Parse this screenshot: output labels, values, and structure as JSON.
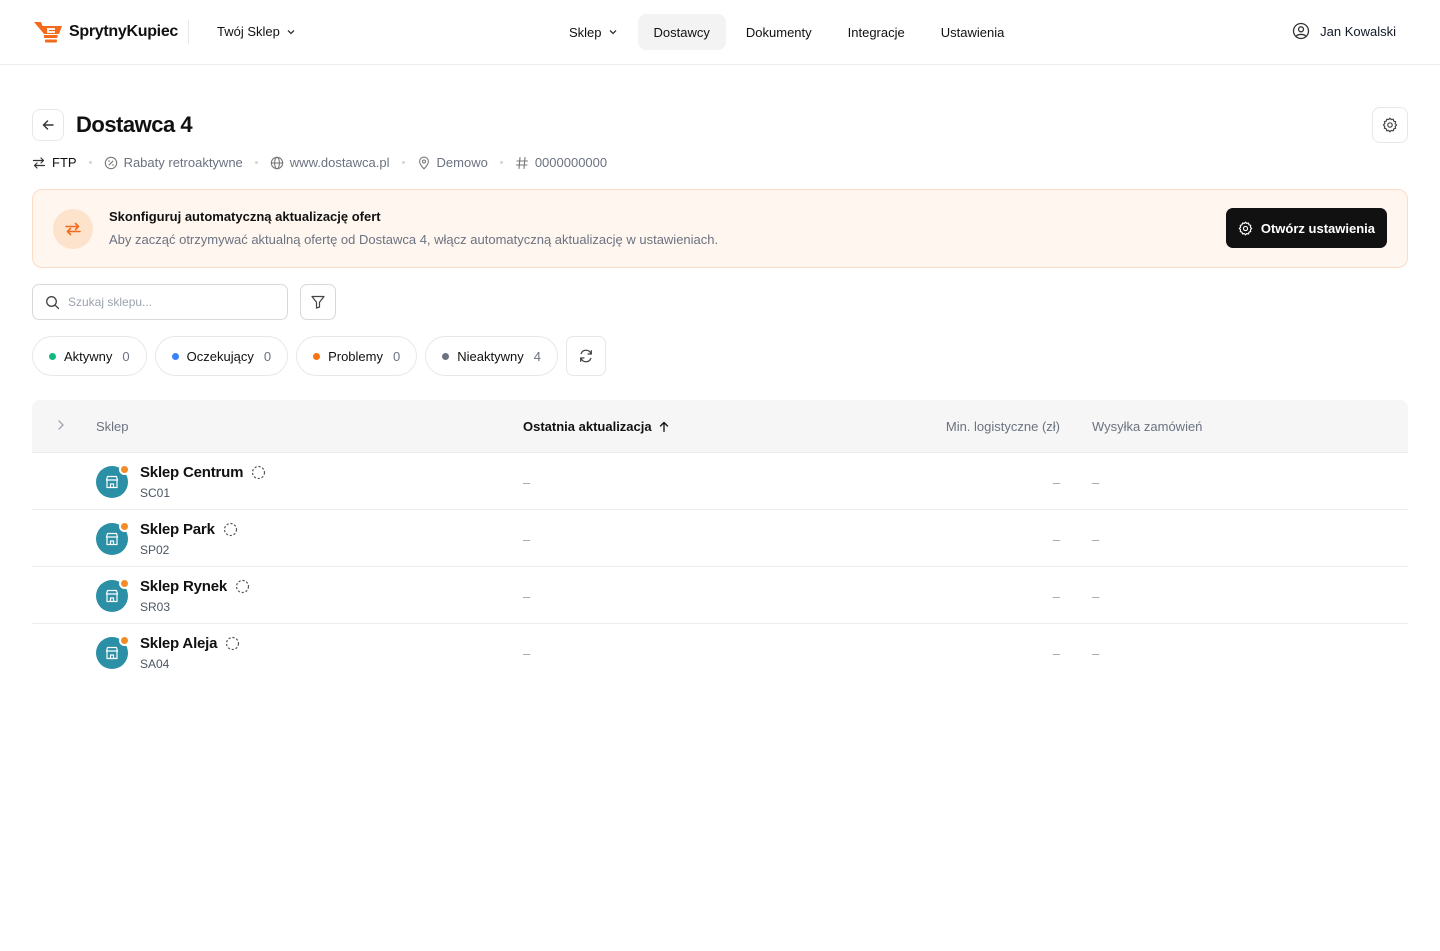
{
  "brand": {
    "name": "SprytnyKupiec",
    "accent": "#f26a1b"
  },
  "store_selector": {
    "label": "Twój Sklep"
  },
  "nav": {
    "items": [
      {
        "label": "Sklep",
        "has_dropdown": true
      },
      {
        "label": "Dostawcy",
        "active": true
      },
      {
        "label": "Dokumenty"
      },
      {
        "label": "Integracje"
      },
      {
        "label": "Ustawienia"
      }
    ]
  },
  "user": {
    "name": "Jan Kowalski"
  },
  "page": {
    "title": "Dostawca 4",
    "meta": {
      "integration": "FTP",
      "discounts": "Rabaty retroaktywne",
      "website": "www.dostawca.pl",
      "location": "Demowo",
      "tax_id": "0000000000"
    }
  },
  "banner": {
    "title": "Skonfiguruj automatyczną aktualizację ofert",
    "text": "Aby zacząć otrzymywać aktualną ofertę od Dostawca 4, włącz automatyczną aktualizację w ustawieniach.",
    "button": "Otwórz ustawienia"
  },
  "search": {
    "placeholder": "Szukaj sklepu..."
  },
  "status_pills": [
    {
      "label": "Aktywny",
      "count": "0",
      "color": "#10b981"
    },
    {
      "label": "Oczekujący",
      "count": "0",
      "color": "#3b82f6"
    },
    {
      "label": "Problemy",
      "count": "0",
      "color": "#f97316"
    },
    {
      "label": "Nieaktywny",
      "count": "4",
      "color": "#6b7280"
    }
  ],
  "table": {
    "columns": {
      "store": "Sklep",
      "last_update": "Ostatnia aktualizacja",
      "min_logistics": "Min. logistyczne (zł)",
      "shipping": "Wysyłka zamówień"
    },
    "rows": [
      {
        "name": "Sklep Centrum",
        "code": "SC01",
        "last_update": "–",
        "min_logistics": "–",
        "shipping": "–"
      },
      {
        "name": "Sklep Park",
        "code": "SP02",
        "last_update": "–",
        "min_logistics": "–",
        "shipping": "–"
      },
      {
        "name": "Sklep Rynek",
        "code": "SR03",
        "last_update": "–",
        "min_logistics": "–",
        "shipping": "–"
      },
      {
        "name": "Sklep Aleja",
        "code": "SA04",
        "last_update": "–",
        "min_logistics": "–",
        "shipping": "–"
      }
    ]
  }
}
